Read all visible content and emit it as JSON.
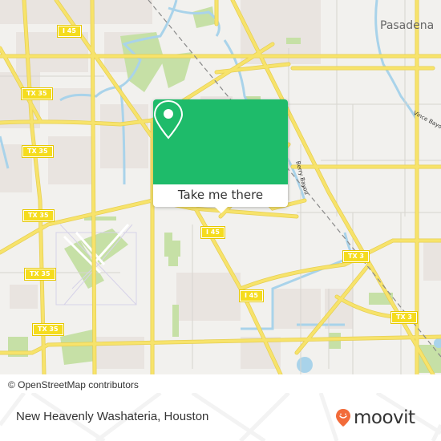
{
  "map": {
    "shields": [
      {
        "id": "i45-top",
        "label": "I 45"
      },
      {
        "id": "tx35-a",
        "label": "TX 35"
      },
      {
        "id": "tx35-b",
        "label": "TX 35"
      },
      {
        "id": "tx35-c",
        "label": "TX 35"
      },
      {
        "id": "tx35-d",
        "label": "TX 35"
      },
      {
        "id": "tx35-e",
        "label": "TX 35"
      },
      {
        "id": "i45-mid",
        "label": "I 45"
      },
      {
        "id": "i45-low",
        "label": "I 45"
      },
      {
        "id": "tx3-a",
        "label": "TX 3"
      },
      {
        "id": "tx3-b",
        "label": "TX 3"
      }
    ],
    "place_labels": [
      {
        "label": "Pasadena"
      }
    ],
    "street_labels": [
      {
        "label": "Berry Bayou"
      },
      {
        "label": "Vince Bayou"
      }
    ],
    "colors": {
      "background": "#f2f1ee",
      "road": "#f7e36b",
      "water": "#a9d3ea",
      "park": "#c6e0a6",
      "urban": "#e9e4e0"
    }
  },
  "popup": {
    "icon": "map-pin-icon",
    "button_label": "Take me there",
    "color": "#1ebb6a"
  },
  "attribution": "© OpenStreetMap contributors",
  "footer": {
    "place_name": "New Heavenly Washateria, Houston",
    "brand": "moovit",
    "brand_icon": "moovit-pin-icon",
    "brand_color": "#f26b3a"
  }
}
